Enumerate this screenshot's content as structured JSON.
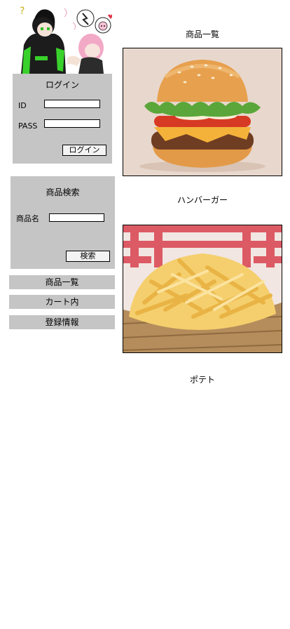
{
  "banner": {
    "icon": "anime-characters-illustration"
  },
  "login": {
    "title": "ログイン",
    "id_label": "ID",
    "id_value": "",
    "pass_label": "PASS",
    "pass_value": "",
    "button_label": "ログイン"
  },
  "search": {
    "title": "商品検索",
    "name_label": "商品名",
    "name_value": "",
    "button_label": "検索"
  },
  "nav": [
    {
      "label": "商品一覧"
    },
    {
      "label": "カート内"
    },
    {
      "label": "登録情報"
    }
  ],
  "main": {
    "title": "商品一覧",
    "products": [
      {
        "name": "ハンバーガー",
        "image": "hamburger-photo"
      },
      {
        "name": "ポテト",
        "image": "french-fries-photo"
      }
    ]
  },
  "colors": {
    "panel": "#c5c5c5",
    "background": "#ffffff"
  }
}
